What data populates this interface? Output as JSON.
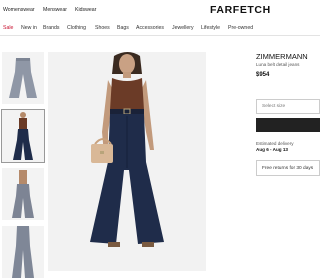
{
  "header": {
    "departments": [
      "Womenswear",
      "Menswear",
      "Kidswear"
    ],
    "logo": "FARFETCH"
  },
  "categories": [
    "Sale",
    "New in",
    "Brands",
    "Clothing",
    "Shoes",
    "Bags",
    "Accessories",
    "Jewellery",
    "Lifestyle",
    "Pre-owned"
  ],
  "product": {
    "brand": "ZIMMERMANN",
    "name": "Luna belt detail jeans",
    "price": "$954",
    "size_placeholder": "Select size",
    "estimated_delivery_label": "Estimated delivery",
    "estimated_delivery_dates": "Aug 6 - Aug 13",
    "returns_text": "Free returns for 30 days"
  },
  "colors": {
    "sale": "#c8102e",
    "denim": "#1f2c4a",
    "tank": "#6b3b27",
    "button": "#222222"
  }
}
